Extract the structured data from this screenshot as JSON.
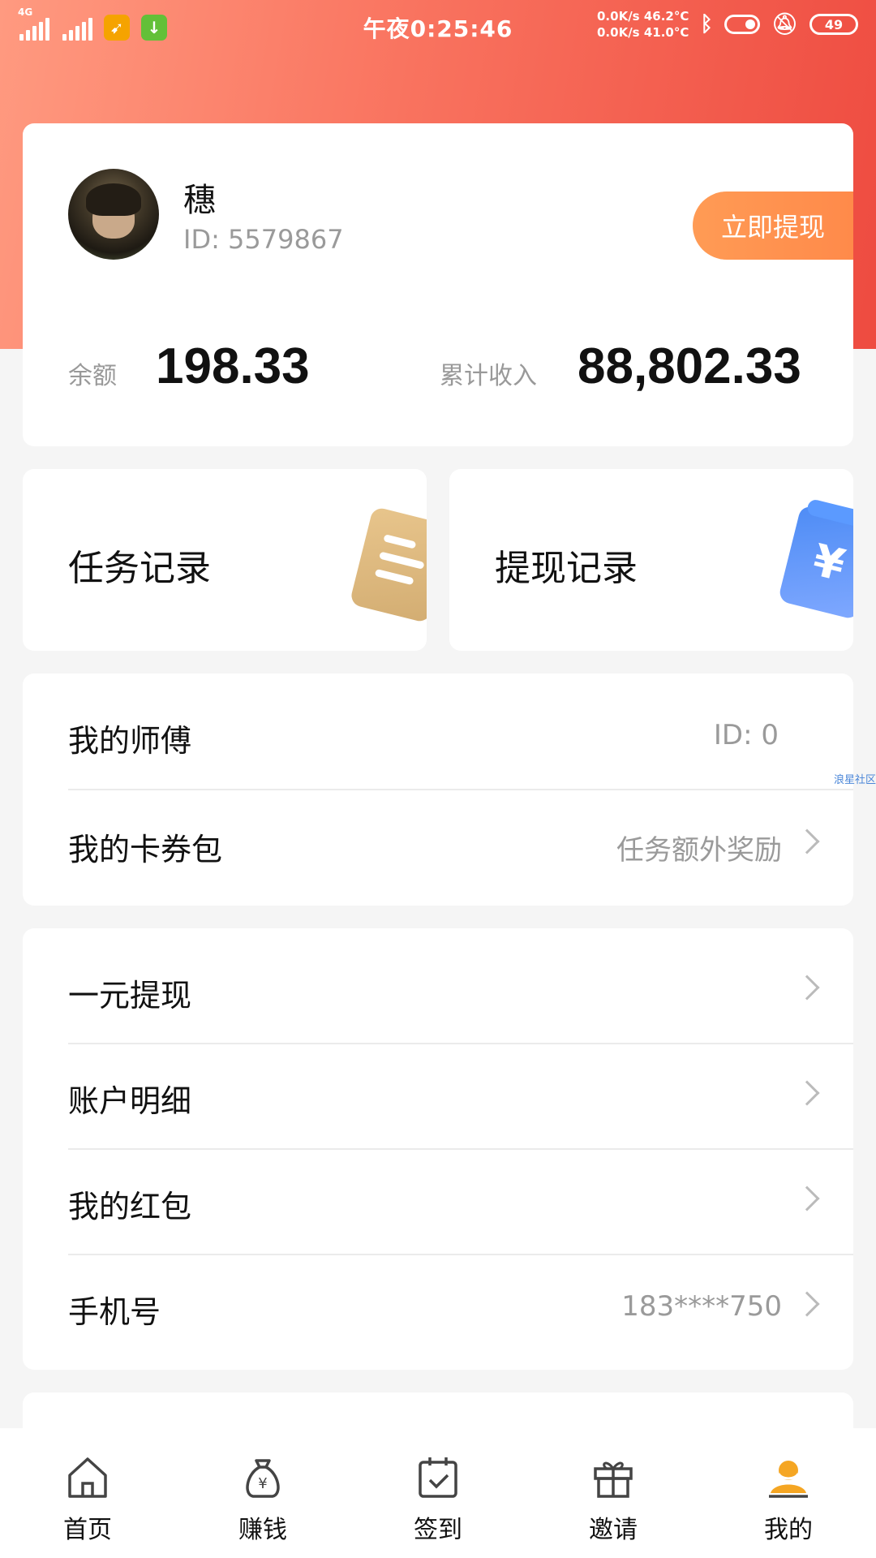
{
  "status_bar": {
    "network_label": "4G",
    "time": "午夜0:25:46",
    "net_speed_up": "0.0K/s",
    "net_speed_down": "0.0K/s",
    "temp_1": "46.2°C",
    "temp_2": "41.0°C",
    "battery": "49"
  },
  "profile": {
    "username": "穗",
    "user_id": "ID: 5579867",
    "withdraw_button": "立即提现",
    "balance_label": "余额",
    "balance_value": "198.33",
    "total_income_label": "累计收入",
    "total_income_value": "88,802.33"
  },
  "records": {
    "task_record": "任务记录",
    "withdraw_record": "提现记录",
    "money_symbol": "¥"
  },
  "list_group_1": [
    {
      "label": "我的师傅",
      "value": "ID: 0"
    },
    {
      "label": "我的卡券包",
      "value": "任务额外奖励"
    }
  ],
  "list_group_2": [
    {
      "label": "一元提现",
      "value": ""
    },
    {
      "label": "账户明细",
      "value": ""
    },
    {
      "label": "我的红包",
      "value": ""
    },
    {
      "label": "手机号",
      "value": "183****750"
    }
  ],
  "watermark": "浪星社区",
  "tabbar": [
    {
      "label": "首页",
      "icon": "home-icon"
    },
    {
      "label": "赚钱",
      "icon": "money-bag-icon"
    },
    {
      "label": "签到",
      "icon": "calendar-check-icon"
    },
    {
      "label": "邀请",
      "icon": "gift-icon"
    },
    {
      "label": "我的",
      "icon": "user-icon",
      "active": true
    }
  ],
  "colors": {
    "header_gradient_start": "#ff9a80",
    "header_gradient_end": "#ee4b40",
    "withdraw_button": "#ff8f4d",
    "active_tab": "#f5a623"
  }
}
